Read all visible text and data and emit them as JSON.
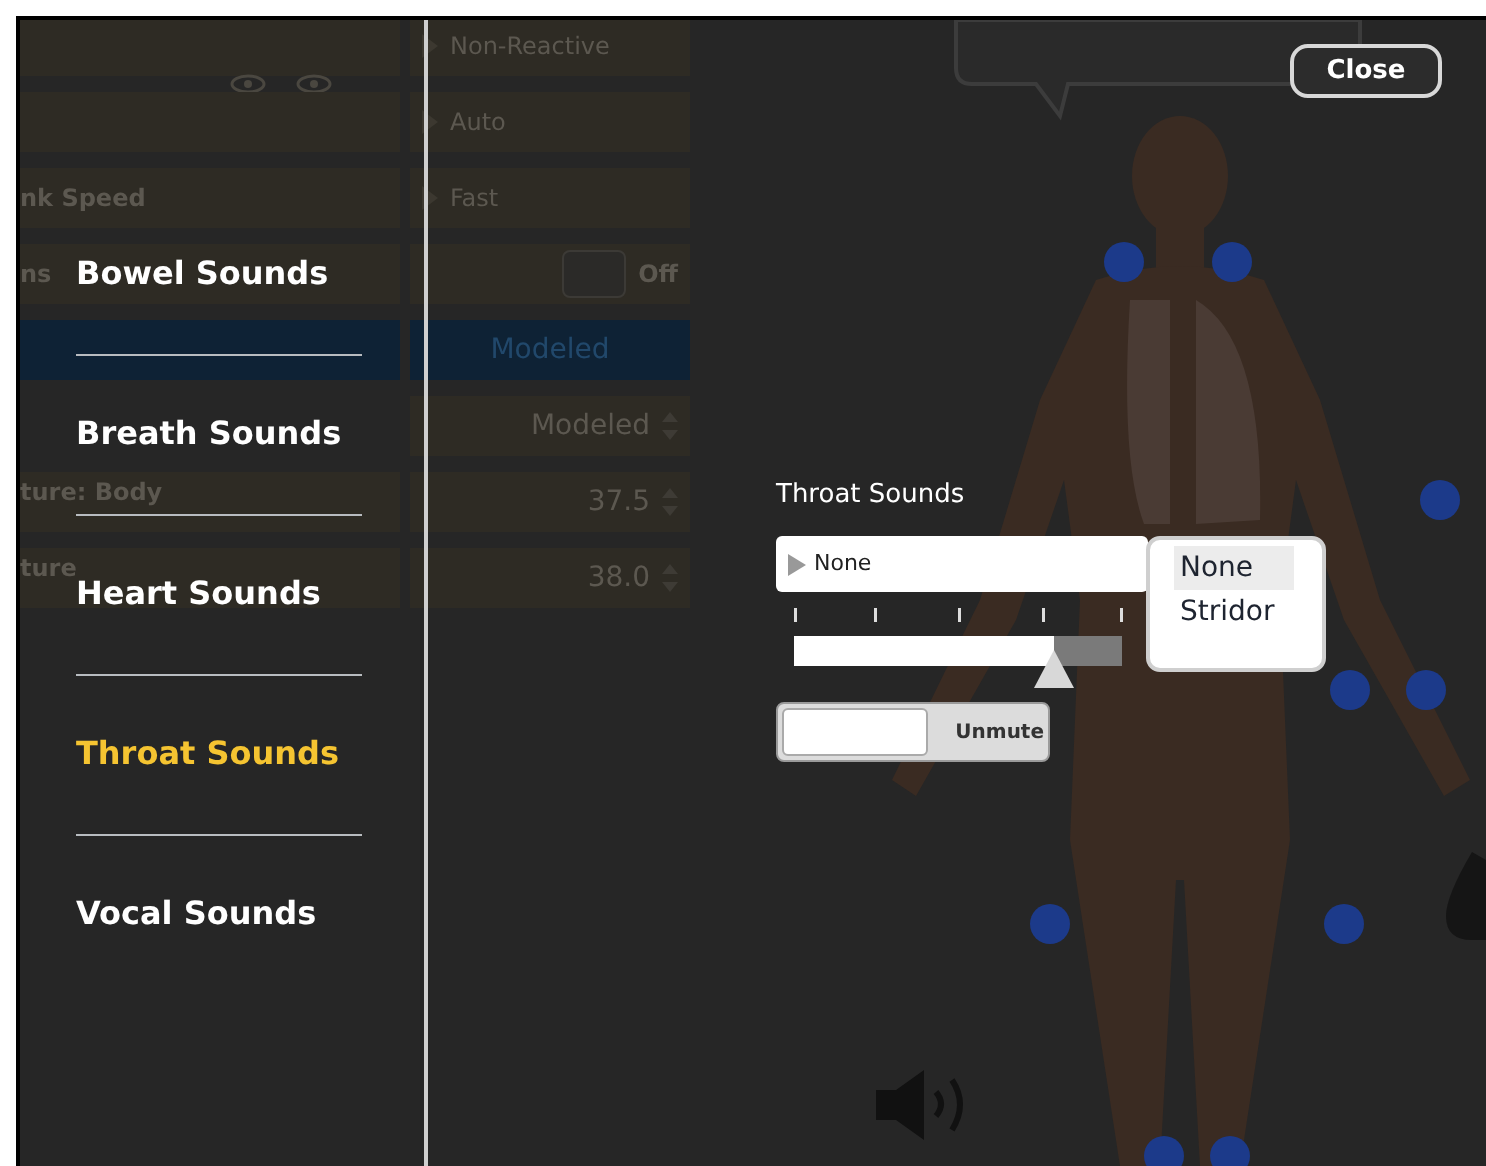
{
  "background_panel": {
    "rows": [
      {
        "kind": "select",
        "label": "",
        "value": "Non-Reactive"
      },
      {
        "kind": "select",
        "label": "",
        "value": "Auto"
      },
      {
        "kind": "select",
        "label": "nk Speed",
        "value": "Fast"
      },
      {
        "kind": "toggle",
        "label": "ns",
        "value": "Off",
        "on": false
      },
      {
        "kind": "bar",
        "label": "",
        "value": "Modeled"
      },
      {
        "kind": "stepper",
        "label": "",
        "value": "Modeled"
      },
      {
        "kind": "stepper",
        "label": "ture: Body",
        "value": "37.5"
      },
      {
        "kind": "stepper",
        "label": "ture",
        "value": "38.0"
      }
    ]
  },
  "sound_menu": {
    "items": [
      {
        "label": "Bowel Sounds",
        "selected": false
      },
      {
        "label": "Breath Sounds",
        "selected": false
      },
      {
        "label": "Heart Sounds",
        "selected": false
      },
      {
        "label": "Throat Sounds",
        "selected": true
      },
      {
        "label": "Vocal Sounds",
        "selected": false
      }
    ]
  },
  "close_button": "Close",
  "throat_panel": {
    "title": "Throat Sounds",
    "select": {
      "value": "None"
    },
    "volume": {
      "level": 0.79
    },
    "mute_toggle": {
      "label": "Unmute"
    }
  },
  "dropdown": {
    "options": [
      {
        "label": "None",
        "selected": true
      },
      {
        "label": "Stridor",
        "selected": false
      }
    ]
  }
}
